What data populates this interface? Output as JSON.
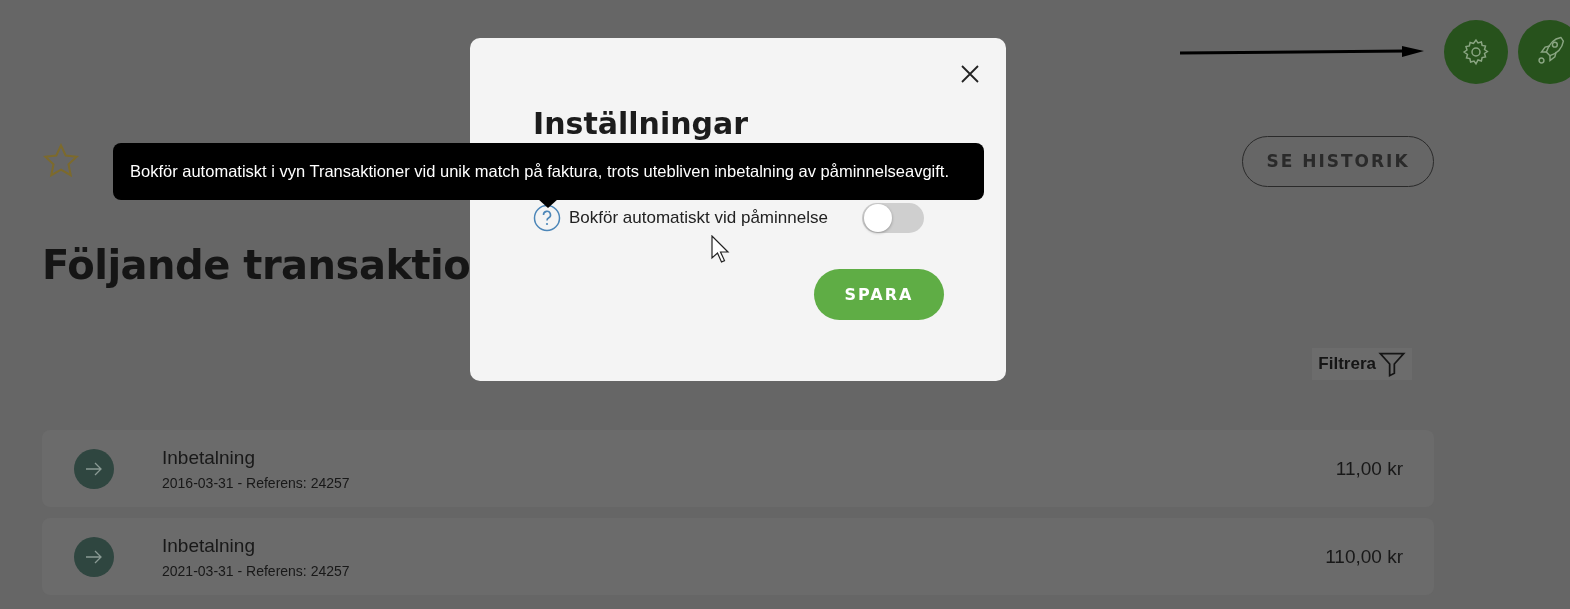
{
  "history_button": "SE HISTORIK",
  "heading": "Följande transaktio",
  "filter": {
    "label": "Filtrera"
  },
  "transactions": [
    {
      "title": "Inbetalning",
      "detail": "2016-03-31 - Referens: 24257",
      "amount": "11,00 kr"
    },
    {
      "title": "Inbetalning",
      "detail": "2021-03-31 - Referens: 24257",
      "amount": "110,00 kr"
    }
  ],
  "modal": {
    "title": "Inställningar",
    "settings": [
      {
        "label": "Bokför automatiskt vid påminnelse",
        "on": false
      }
    ],
    "save": "SPARA"
  },
  "tooltip": "Bokför automatiskt i vyn Transaktioner vid unik match på faktura, trots utebliven inbetalning av påminnelseavgift."
}
